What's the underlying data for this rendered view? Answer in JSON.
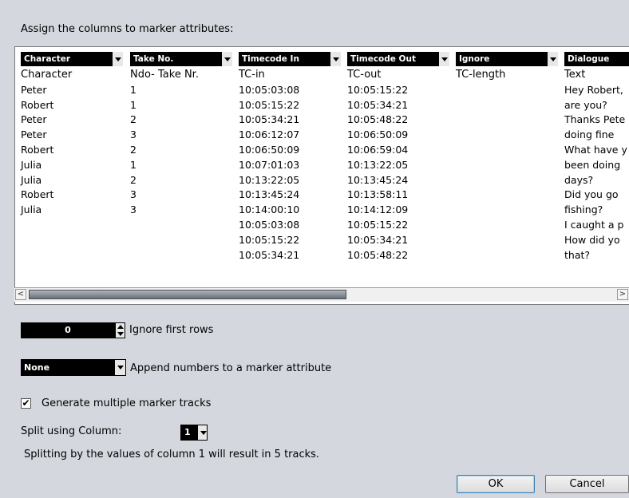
{
  "title": "Assign the columns to marker attributes:",
  "columns": [
    {
      "header": "Character",
      "cells": [
        "Character",
        "Peter",
        "Robert",
        "Peter",
        "Peter",
        "Robert",
        "Julia",
        "Julia",
        "Robert",
        "Julia",
        "",
        "",
        ""
      ]
    },
    {
      "header": "Take No.",
      "cells": [
        "Ndo- Take Nr.",
        "1",
        "1",
        "2",
        "3",
        "2",
        "1",
        "2",
        "3",
        "3",
        "",
        "",
        ""
      ]
    },
    {
      "header": "Timecode In",
      "cells": [
        "TC-in",
        "10:05:03:08",
        "10:05:15:22",
        "10:05:34:21",
        "10:06:12:07",
        "10:06:50:09",
        "10:07:01:03",
        "10:13:22:05",
        "10:13:45:24",
        "10:14:00:10",
        "10:05:03:08",
        "10:05:15:22",
        "10:05:34:21"
      ]
    },
    {
      "header": "Timecode Out",
      "cells": [
        "TC-out",
        "10:05:15:22",
        "10:05:34:21",
        "10:05:48:22",
        "10:06:50:09",
        "10:06:59:04",
        "10:13:22:05",
        "10:13:45:24",
        "10:13:58:11",
        "10:14:12:09",
        "10:05:15:22",
        "10:05:34:21",
        "10:05:48:22"
      ]
    },
    {
      "header": "Ignore",
      "cells": [
        "TC-length",
        "",
        "",
        "",
        "",
        "",
        "",
        "",
        "",
        "",
        "",
        "",
        ""
      ]
    },
    {
      "header": "Dialogue",
      "cells": [
        "Text",
        "Hey Robert,",
        "are you?",
        "Thanks Pete",
        "doing fine",
        "What have y",
        "been doing",
        "days?",
        "Did you go",
        "fishing?",
        "I caught a p",
        "How did yo",
        "that?"
      ]
    }
  ],
  "scroll_left": "<",
  "scroll_right": ">",
  "ignore_rows": {
    "value": "0",
    "label": "Ignore first rows"
  },
  "append": {
    "selected": "None",
    "label": "Append numbers to a marker attribute"
  },
  "generate": {
    "checked": "✔",
    "label": "Generate multiple marker tracks"
  },
  "split": {
    "label": "Split using Column:",
    "selected": "1",
    "info": "Splitting by the values of column 1 will result in 5 tracks."
  },
  "buttons": {
    "ok": "OK",
    "cancel": "Cancel"
  }
}
